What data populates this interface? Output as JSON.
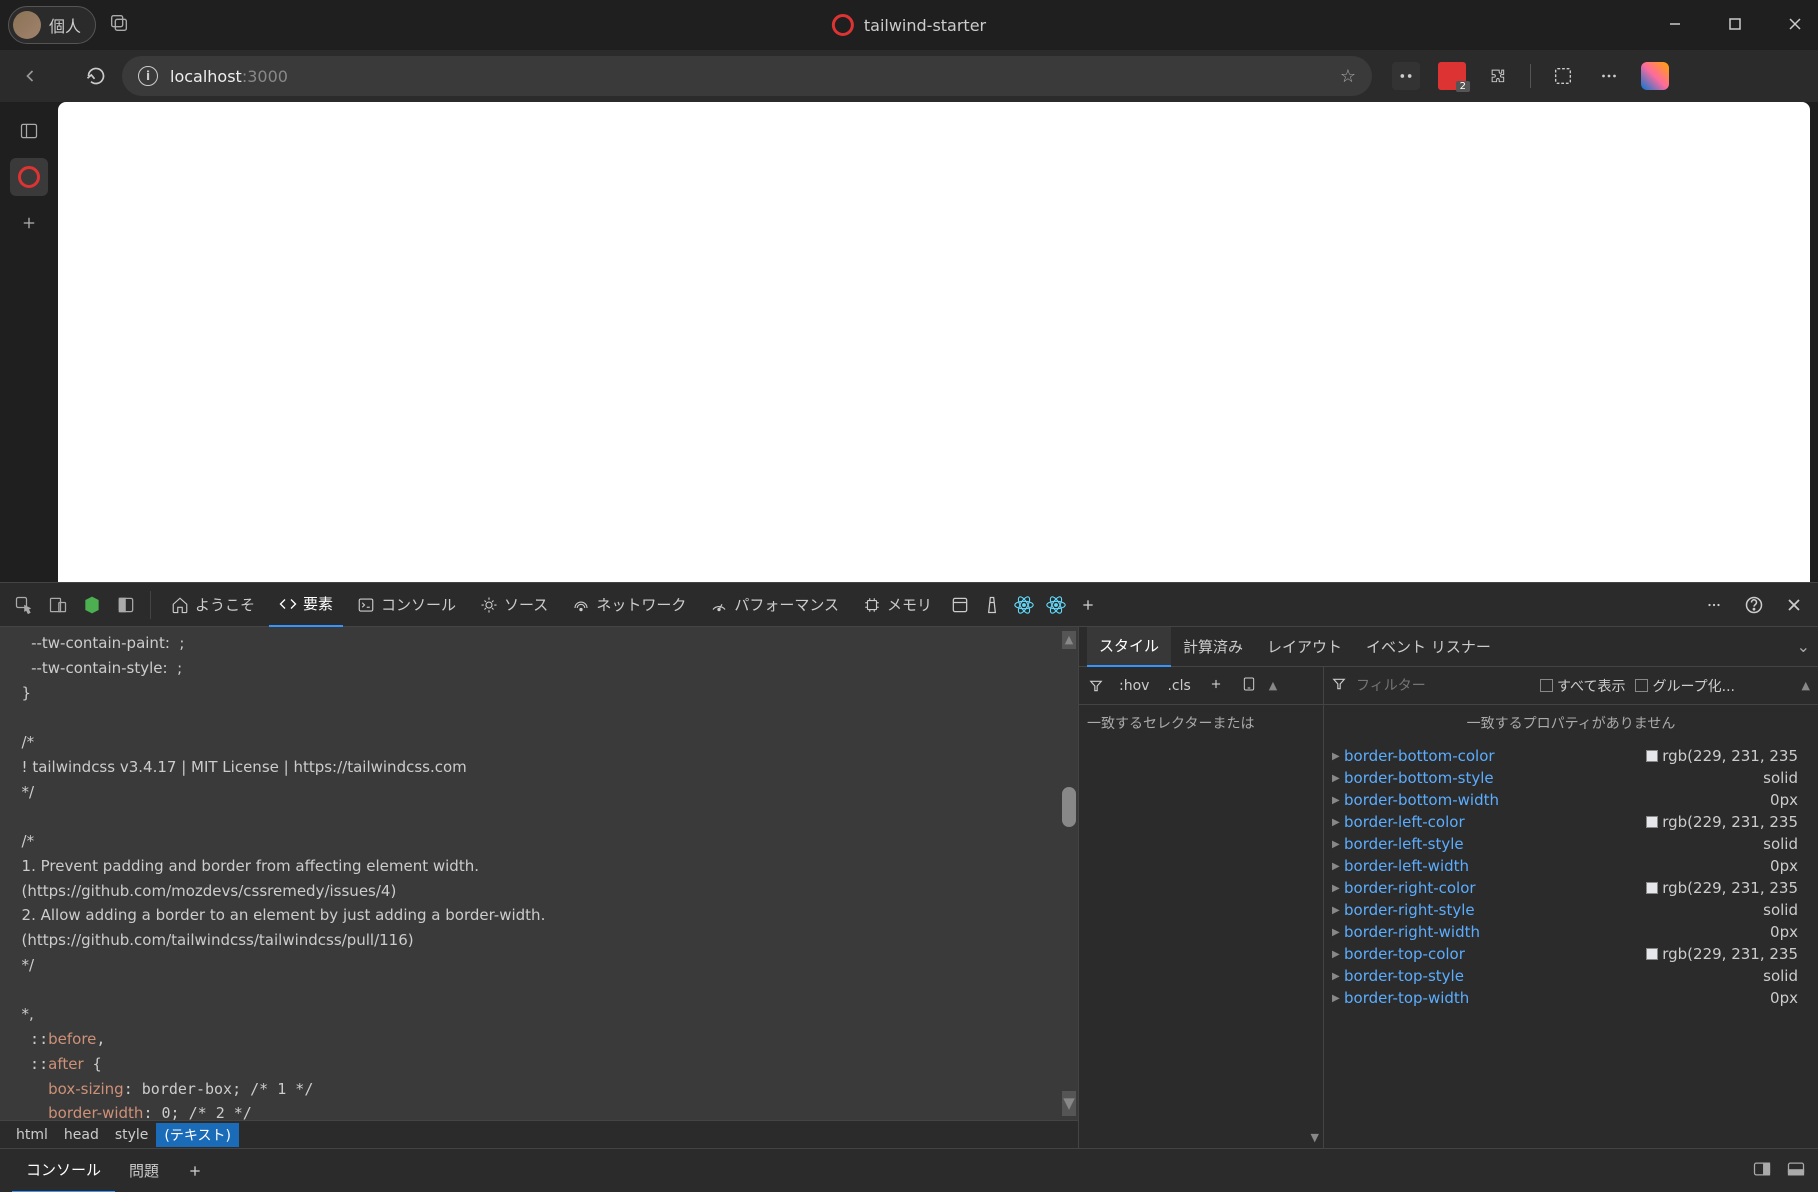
{
  "titlebar": {
    "profile_label": "個人",
    "page_title": "tailwind-starter"
  },
  "toolbar": {
    "url_host": "localhost",
    "url_port": ":3000",
    "ext_badge": "2"
  },
  "devtools": {
    "tabs": {
      "welcome": "ようこそ",
      "elements": "要素",
      "console": "コンソール",
      "sources": "ソース",
      "network": "ネットワーク",
      "performance": "パフォーマンス",
      "memory": "メモリ"
    },
    "code_lines": [
      "    --tw-contain-paint:  ;",
      "    --tw-contain-style:  ;",
      "  }",
      "",
      "  /*",
      "  ! tailwindcss v3.4.17 | MIT License | https://tailwindcss.com",
      "  */",
      "",
      "  /*",
      "  1. Prevent padding and border from affecting element width.",
      "  (https://github.com/mozdevs/cssremedy/issues/4)",
      "  2. Allow adding a border to an element by just adding a border-width.",
      "  (https://github.com/tailwindcss/tailwindcss/pull/116)",
      "  */",
      "",
      "  *,",
      "  ::before,",
      "  ::after {",
      "    box-sizing: border-box; /* 1 */",
      "    border-width: 0; /* 2 */"
    ],
    "breadcrumb": [
      "html",
      "head",
      "style",
      "(テキスト)"
    ],
    "side_tabs": {
      "styles": "スタイル",
      "computed": "計算済み",
      "layout": "レイアウト",
      "event_listeners": "イベント リスナー"
    },
    "styles_toolbar": {
      "hov": ":hov",
      "cls": ".cls"
    },
    "styles_empty": "一致するセレクターまたは",
    "computed_toolbar": {
      "filter_placeholder": "フィルター",
      "show_all": "すべて表示",
      "group": "グループ化..."
    },
    "computed_empty": "一致するプロパティがありません",
    "computed_props": [
      {
        "name": "border-bottom-color",
        "value": "rgb(229, 231, 235",
        "swatch": true
      },
      {
        "name": "border-bottom-style",
        "value": "solid",
        "swatch": false
      },
      {
        "name": "border-bottom-width",
        "value": "0px",
        "swatch": false
      },
      {
        "name": "border-left-color",
        "value": "rgb(229, 231, 235",
        "swatch": true
      },
      {
        "name": "border-left-style",
        "value": "solid",
        "swatch": false
      },
      {
        "name": "border-left-width",
        "value": "0px",
        "swatch": false
      },
      {
        "name": "border-right-color",
        "value": "rgb(229, 231, 235",
        "swatch": true
      },
      {
        "name": "border-right-style",
        "value": "solid",
        "swatch": false
      },
      {
        "name": "border-right-width",
        "value": "0px",
        "swatch": false
      },
      {
        "name": "border-top-color",
        "value": "rgb(229, 231, 235",
        "swatch": true
      },
      {
        "name": "border-top-style",
        "value": "solid",
        "swatch": false
      },
      {
        "name": "border-top-width",
        "value": "0px",
        "swatch": false
      }
    ],
    "drawer": {
      "console": "コンソール",
      "issues": "問題"
    }
  }
}
